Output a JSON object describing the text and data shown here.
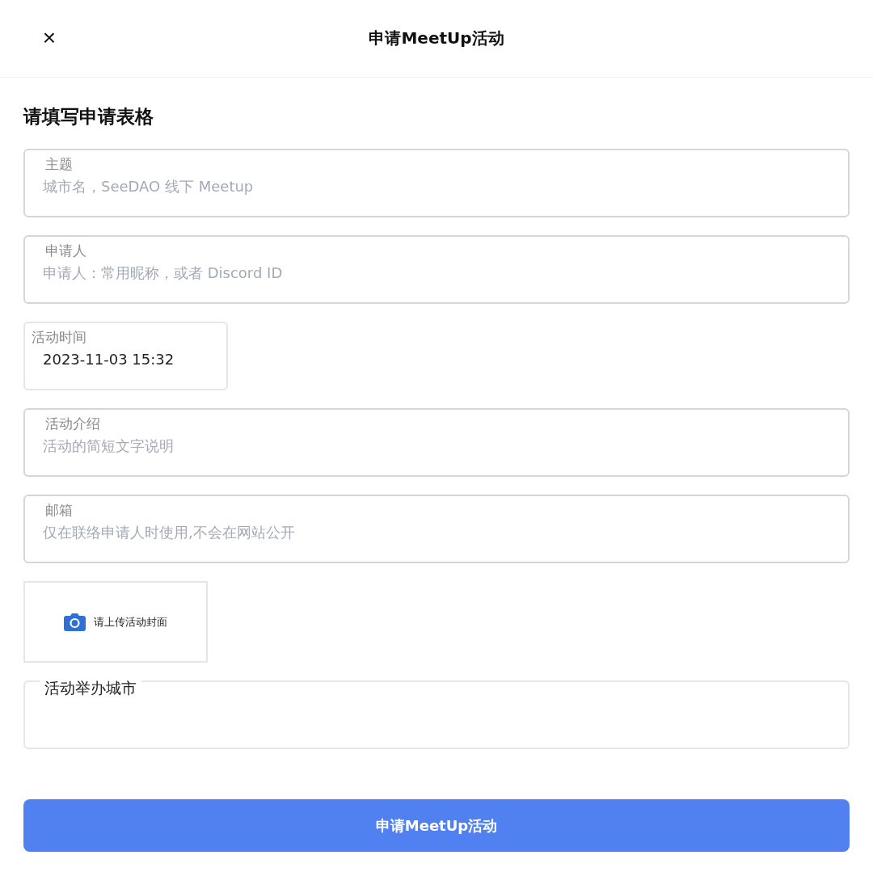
{
  "header": {
    "close": "×",
    "title": "申请MeetUp活动"
  },
  "form": {
    "heading": "请填写申请表格",
    "fields": [
      {
        "kind": "text",
        "label": "主题",
        "placeholder": "城市名，SeeDAO 线下 Meetup"
      },
      {
        "kind": "text",
        "label": "申请人",
        "placeholder": "申请人：常用昵称，或者 Discord ID"
      },
      {
        "kind": "datetime",
        "label": "活动时间",
        "value": "2023-11-03 15:32"
      },
      {
        "kind": "text",
        "label": "活动介绍",
        "placeholder": "活动的简短文字说明"
      },
      {
        "kind": "text",
        "label": "邮箱",
        "placeholder": "仅在联络申请人时使用,不会在网站公开"
      },
      {
        "kind": "upload",
        "label": "请上传活动封面"
      },
      {
        "kind": "select",
        "label": "活动举办城市"
      }
    ],
    "submit": "申请MeetUp活动"
  }
}
